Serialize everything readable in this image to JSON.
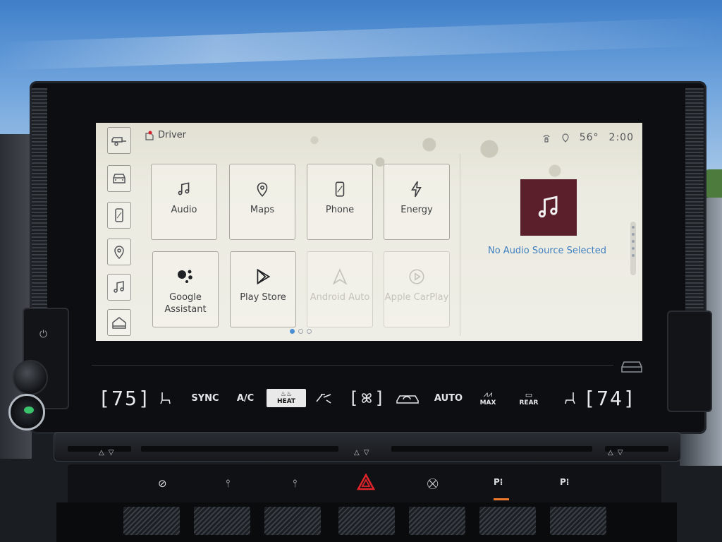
{
  "status": {
    "profile": "Driver",
    "temperature": "56°",
    "time": "2:00"
  },
  "rail": [
    {
      "icon": "trailer-icon"
    },
    {
      "icon": "vehicle-front-icon"
    },
    {
      "icon": "phone-icon"
    },
    {
      "icon": "location-pin-icon"
    },
    {
      "icon": "music-note-icon"
    },
    {
      "icon": "home-icon"
    }
  ],
  "apps": [
    {
      "label": "Audio",
      "icon": "music-note-icon",
      "enabled": true
    },
    {
      "label": "Maps",
      "icon": "location-pin-icon",
      "enabled": true
    },
    {
      "label": "Phone",
      "icon": "phone-icon",
      "enabled": true
    },
    {
      "label": "Energy",
      "icon": "lightning-icon",
      "enabled": true
    },
    {
      "label": "Google Assistant",
      "icon": "google-assistant-icon",
      "enabled": true
    },
    {
      "label": "Play Store",
      "icon": "play-store-icon",
      "enabled": true
    },
    {
      "label": "Android Auto",
      "icon": "android-auto-icon",
      "enabled": false
    },
    {
      "label": "Apple CarPlay",
      "icon": "apple-carplay-icon",
      "enabled": false
    }
  ],
  "audio": {
    "message": "No Audio Source Selected",
    "art_color": "#5a1f2a"
  },
  "climate": {
    "driver_temp": "75",
    "passenger_temp": "74",
    "sync": "SYNC",
    "ac": "A/C",
    "heat": "HEAT",
    "auto": "AUTO",
    "max": "MAX",
    "rear": "REAR"
  },
  "colors": {
    "accent_blue": "#3f7fbf",
    "hazard_red": "#e0242b",
    "indicator_orange": "#f07a2a"
  }
}
